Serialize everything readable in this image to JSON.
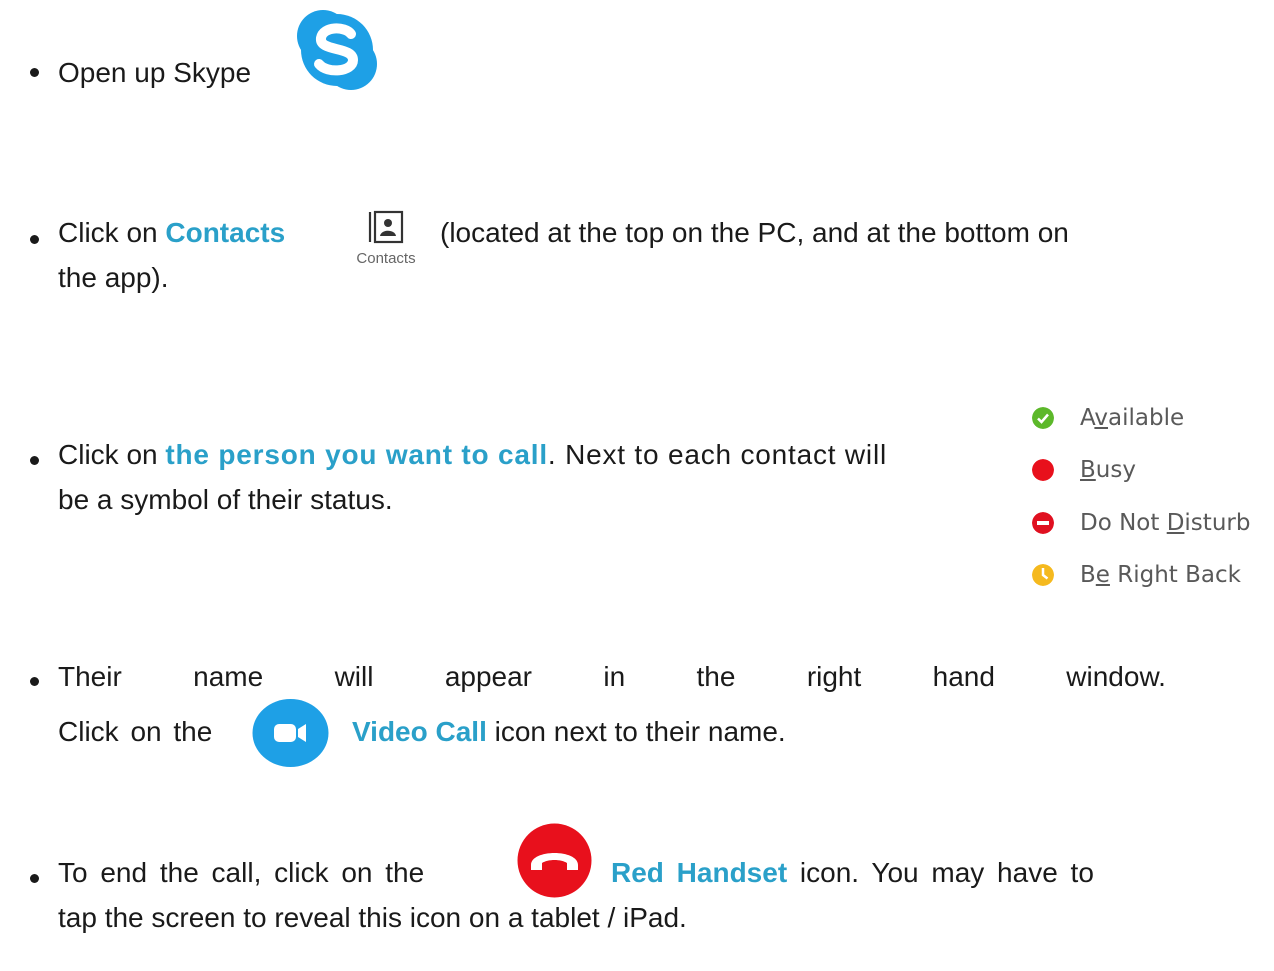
{
  "step1": {
    "text": "Open up Skype"
  },
  "step2": {
    "pre": "Click on ",
    "highlight": "Contacts",
    "post": "(located at the top on the PC, and at the bottom on",
    "line2": "the app).",
    "icon_caption": "Contacts"
  },
  "step3": {
    "pre": "Click on ",
    "highlight": "the person you want to call",
    "post": ". Next to each contact will",
    "line2": "be a symbol of their status."
  },
  "statuses": [
    {
      "label_a": "A",
      "label_u": "v",
      "label_b": "ailable",
      "color": "#5cb82a",
      "icon": "check-circle-icon"
    },
    {
      "label_a": "",
      "label_u": "B",
      "label_b": "usy",
      "color": "#e8101c",
      "icon": "red-dot-icon"
    },
    {
      "label_a": "Do Not ",
      "label_u": "D",
      "label_b": "isturb",
      "color": "#e01020",
      "icon": "minus-circle-icon"
    },
    {
      "label_a": "B",
      "label_u": "e",
      "label_b": " Right Back",
      "color": "#f5b91e",
      "icon": "clock-icon"
    }
  ],
  "step4": {
    "w1": "Their",
    "w2": "name",
    "w3": "will",
    "w4": "appear",
    "w5": "in",
    "w6": "the",
    "w7": "right",
    "w8": "hand",
    "w9": "window.",
    "pre": "Click on the",
    "highlight": "Video Call",
    "post": " icon next to their name."
  },
  "step5": {
    "pre": "To end the call, click on the",
    "highlight": "Red Handset",
    "post": " icon. You may have to",
    "line2": "tap the screen to reveal this icon on a tablet / iPad."
  },
  "colors": {
    "accent": "#2aa0c9",
    "skype": "#1ea0e6",
    "end_call": "#e8101c"
  }
}
